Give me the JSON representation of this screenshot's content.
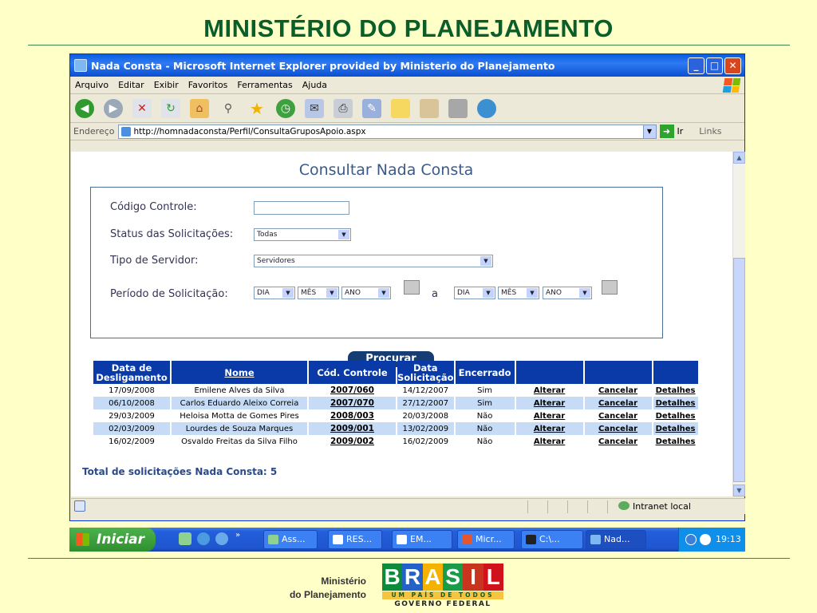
{
  "slide": {
    "title": "MINISTÉRIO DO PLANEJAMENTO",
    "footer_line1": "Ministério",
    "footer_line2": "do Planejamento",
    "brasil_word": "BRASIL",
    "brasil_tagline": "UM PAÍS DE TODOS",
    "brasil_gov": "GOVERNO FEDERAL"
  },
  "window": {
    "title": "Nada Consta - Microsoft Internet Explorer provided by Ministerio do Planejamento",
    "menu": [
      "Arquivo",
      "Editar",
      "Exibir",
      "Favoritos",
      "Ferramentas",
      "Ajuda"
    ],
    "address_label": "Endereço",
    "address_url": "http://homnadaconsta/Perfil/ConsultaGruposApoio.aspx",
    "go_label": "Ir",
    "links_label": "Links"
  },
  "page": {
    "heading": "Consultar Nada Consta",
    "codigo_label": "Código Controle:",
    "codigo_value": "",
    "status_label": "Status das Solicitações:",
    "status_value": "Todas",
    "tipo_label": "Tipo de Servidor:",
    "tipo_value": "Servidores",
    "periodo_label": "Período de Solicitação:",
    "dia": "DIA",
    "mes": "MÊS",
    "ano": "ANO",
    "separator": "a",
    "search_button": "Procurar",
    "table": {
      "headers": [
        "Data de Desligamento",
        "Nome",
        "Cód. Controle",
        "Data Solicitação",
        "Encerrado",
        "",
        "",
        ""
      ],
      "rows": [
        {
          "data_desl": "17/09/2008",
          "nome": "Emilene Alves da Silva",
          "codigo": "2007/060",
          "data_sol": "14/12/2007",
          "encerrado": "Sim",
          "alterar": "Alterar",
          "cancelar": "Cancelar",
          "detalhes": "Detalhes"
        },
        {
          "data_desl": "06/10/2008",
          "nome": "Carlos Eduardo Aleixo Correia",
          "codigo": "2007/070",
          "data_sol": "27/12/2007",
          "encerrado": "Sim",
          "alterar": "Alterar",
          "cancelar": "Cancelar",
          "detalhes": "Detalhes"
        },
        {
          "data_desl": "29/03/2009",
          "nome": "Heloisa Motta de Gomes Pires",
          "codigo": "2008/003",
          "data_sol": "20/03/2008",
          "encerrado": "Não",
          "alterar": "Alterar",
          "cancelar": "Cancelar",
          "detalhes": "Detalhes"
        },
        {
          "data_desl": "02/03/2009",
          "nome": "Lourdes de Souza Marques",
          "codigo": "2009/001",
          "data_sol": "13/02/2009",
          "encerrado": "Não",
          "alterar": "Alterar",
          "cancelar": "Cancelar",
          "detalhes": "Detalhes"
        },
        {
          "data_desl": "16/02/2009",
          "nome": "Osvaldo Freitas da Silva Filho",
          "codigo": "2009/002",
          "data_sol": "16/02/2009",
          "encerrado": "Não",
          "alterar": "Alterar",
          "cancelar": "Cancelar",
          "detalhes": "Detalhes"
        }
      ]
    },
    "total_label": "Total de solicitações Nada Consta: 5"
  },
  "statusbar": {
    "zone": "Intranet local"
  },
  "taskbar": {
    "start": "Iniciar",
    "tasks": [
      "Ass...",
      "RES...",
      "EM...",
      "Micr...",
      "C:\\...",
      "Nad..."
    ],
    "clock": "19:13"
  },
  "colors": {
    "title_green": "#0a5e2a",
    "header_blue": "#0a3aa8",
    "alt_row": "#c6dcf6",
    "button": "#153d74"
  }
}
